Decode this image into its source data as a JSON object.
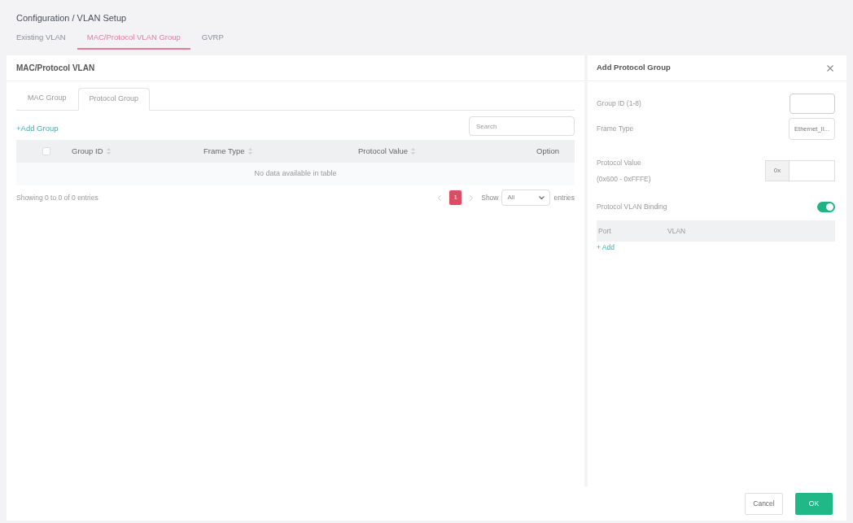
{
  "breadcrumb": "Configuration / VLAN Setup",
  "tabs": [
    {
      "label": "Existing VLAN",
      "selected": false
    },
    {
      "label": "MAC/Protocol VLAN Group",
      "selected": true
    },
    {
      "label": "GVRP",
      "selected": false
    }
  ],
  "panel": {
    "title": "MAC/Protocol VLAN",
    "tabs": [
      {
        "label": "MAC Group",
        "selected": false
      },
      {
        "label": "Protocol Group",
        "selected": true
      }
    ],
    "add_link": "+Add Group",
    "search": {
      "placeholder": "Search"
    },
    "table": {
      "columns": [
        {
          "kind": "checkbox",
          "checked": false
        },
        {
          "kind": "sortable",
          "label": "Group ID"
        },
        {
          "kind": "sortable",
          "label": "Frame Type"
        },
        {
          "kind": "sortable",
          "label": "Protocol Value"
        },
        {
          "kind": "plain",
          "label": "Option"
        }
      ],
      "empty_message": "No data available in table"
    },
    "info": "Showing 0 to 0 of 0 entries",
    "pagination": {
      "pages": [
        {
          "label": "1",
          "selected": true
        }
      ]
    },
    "length": {
      "prefix": "Show",
      "value": "All",
      "suffix": "entries"
    }
  },
  "drawer": {
    "title": "Add Protocol Group",
    "fields": [
      {
        "kind": "input",
        "label": "Group ID (1-8)"
      },
      {
        "kind": "select",
        "label": "Frame Type",
        "value": "Ethernet_II..."
      },
      {
        "kind": "prefixed",
        "label": "Protocol Value",
        "hint": "(0x600 - 0xFFFE)",
        "prefix": "0x"
      },
      {
        "kind": "toggle",
        "label": "Protocol VLAN Binding",
        "on": true
      }
    ],
    "binding_table": {
      "columns": [
        "Port",
        "VLAN"
      ]
    },
    "add_link": "+ Add"
  },
  "footer": {
    "buttons": [
      {
        "kind": "secondary",
        "label": "Cancel"
      },
      {
        "kind": "primary",
        "label": "OK"
      }
    ]
  }
}
